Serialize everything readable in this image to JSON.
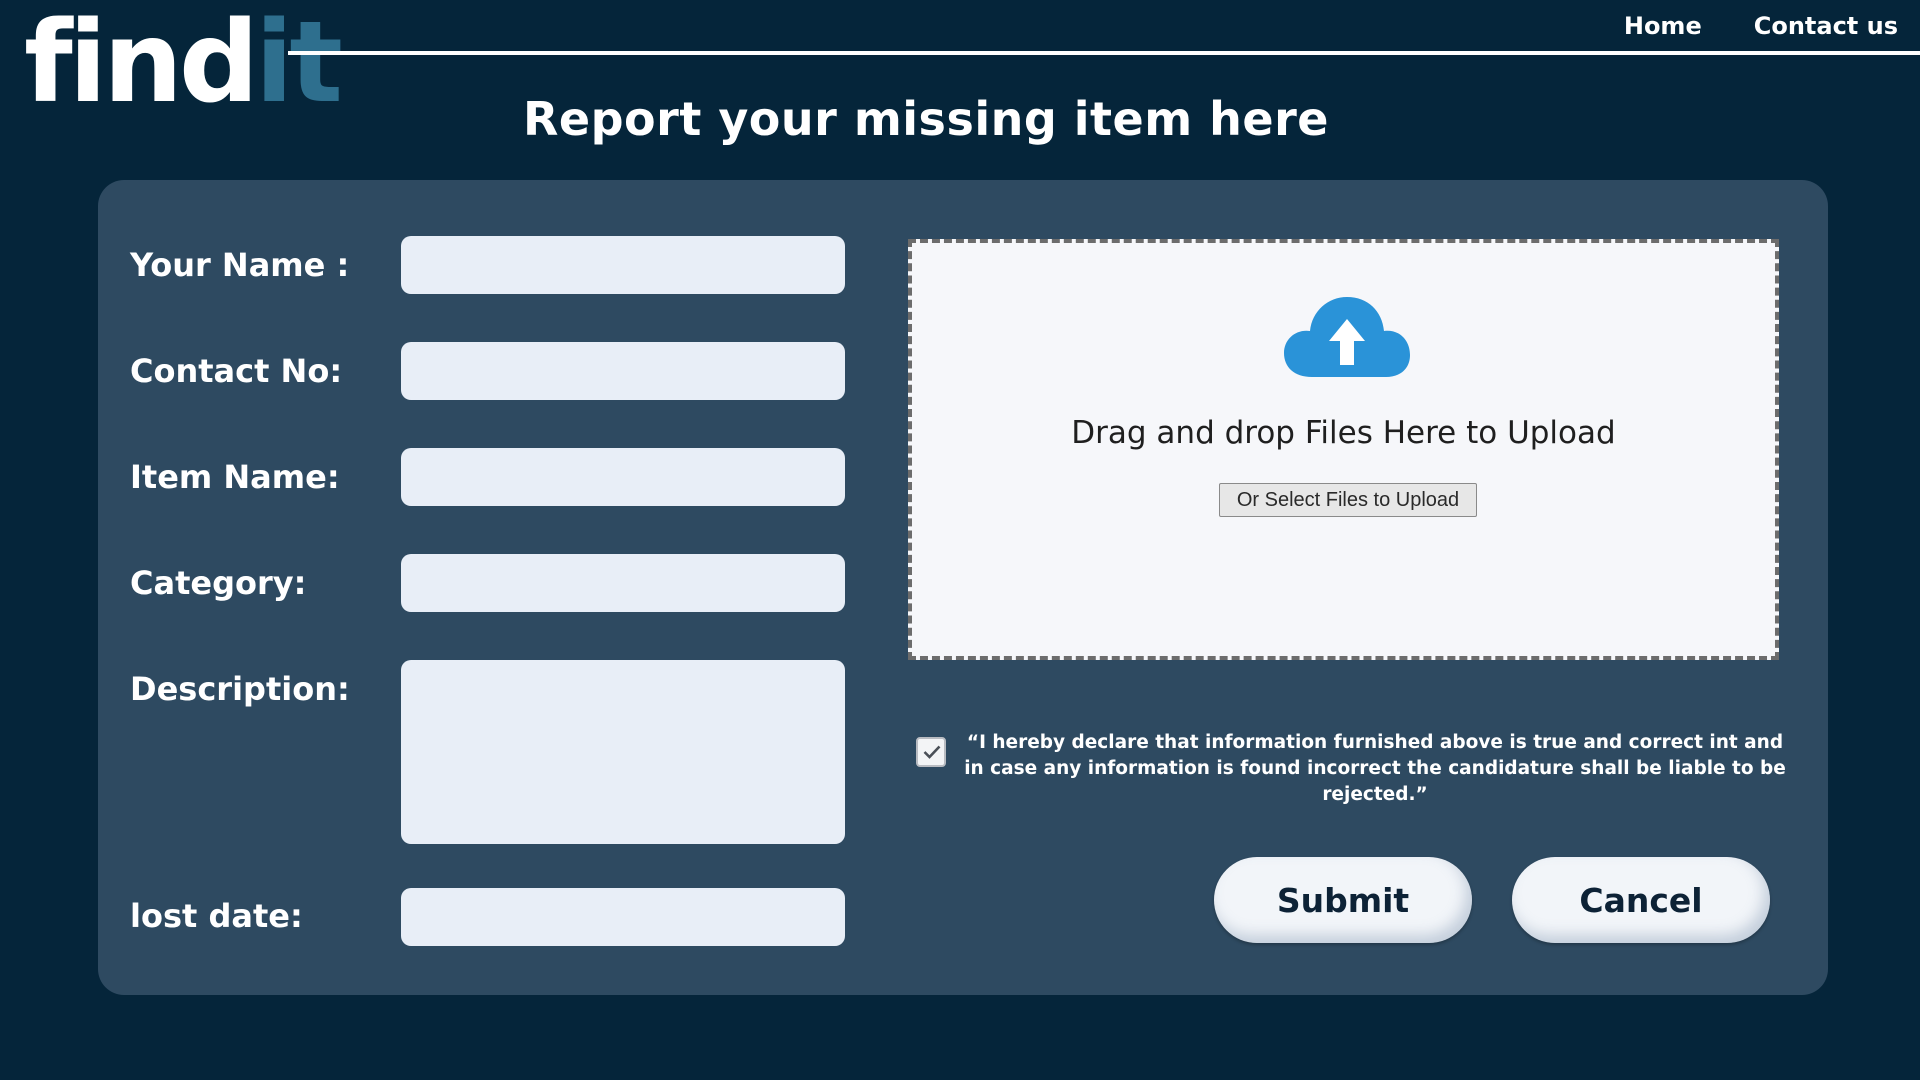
{
  "logo": {
    "part1": "find",
    "part2": "it",
    "part1_color": "#ffffff",
    "part2_color": "#2e6f8e"
  },
  "nav": {
    "items": [
      {
        "label": "Home"
      },
      {
        "label": "Contact us"
      }
    ]
  },
  "page_title": "Report your missing item here",
  "form": {
    "fields": [
      {
        "label": "Your Name :",
        "value": "",
        "placeholder": ""
      },
      {
        "label": "Contact No:",
        "value": "",
        "placeholder": ""
      },
      {
        "label": "Item Name:",
        "value": "",
        "placeholder": ""
      },
      {
        "label": "Category:",
        "value": "",
        "placeholder": ""
      },
      {
        "label": "Description:",
        "value": "",
        "placeholder": ""
      },
      {
        "label": "lost date:",
        "value": "",
        "placeholder": ""
      }
    ]
  },
  "upload": {
    "icon": "cloud-upload-icon",
    "icon_color": "#2a93d8",
    "text": "Drag and drop Files Here to Upload",
    "button_label": "Or Select Files to Upload"
  },
  "declaration": {
    "checked": true,
    "text": "“I hereby declare that information furnished above is true and correct int and in case any information is found incorrect  the candidature shall be liable to be rejected.”"
  },
  "actions": {
    "submit_label": "Submit",
    "cancel_label": "Cancel"
  },
  "colors": {
    "background": "#05253a",
    "card": "#2e4a61",
    "input": "#e8eef7"
  }
}
